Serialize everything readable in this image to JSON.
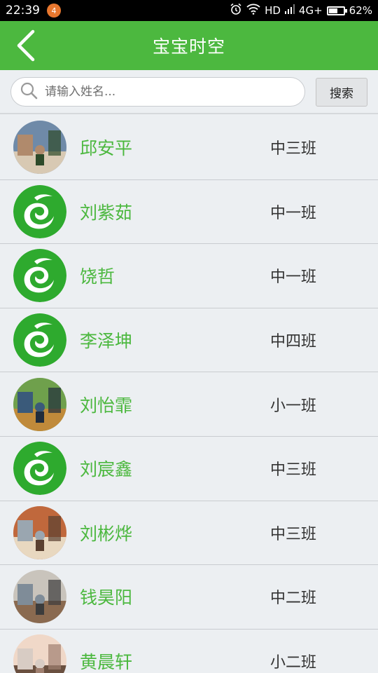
{
  "status_bar": {
    "time": "22:39",
    "notification_count": "4",
    "network": "HD",
    "network_type": "4G+",
    "battery": "62%",
    "battery_level": 0.62
  },
  "header": {
    "title": "宝宝时空"
  },
  "search": {
    "placeholder": "请输入姓名...",
    "button_label": "搜索"
  },
  "students": [
    {
      "name": "邱安平",
      "class": "中三班",
      "avatar": "photo"
    },
    {
      "name": "刘紫茹",
      "class": "中一班",
      "avatar": "logo"
    },
    {
      "name": "饶哲",
      "class": "中一班",
      "avatar": "logo"
    },
    {
      "name": "李泽坤",
      "class": "中四班",
      "avatar": "logo"
    },
    {
      "name": "刘怡霏",
      "class": "小一班",
      "avatar": "photo"
    },
    {
      "name": "刘宸鑫",
      "class": "中三班",
      "avatar": "logo"
    },
    {
      "name": "刘彬烨",
      "class": "中三班",
      "avatar": "photo"
    },
    {
      "name": "钱昊阳",
      "class": "中二班",
      "avatar": "photo"
    },
    {
      "name": "黄晨轩",
      "class": "小二班",
      "avatar": "photo"
    }
  ],
  "colors": {
    "primary": "#4cb83f",
    "background": "#eceff2"
  }
}
